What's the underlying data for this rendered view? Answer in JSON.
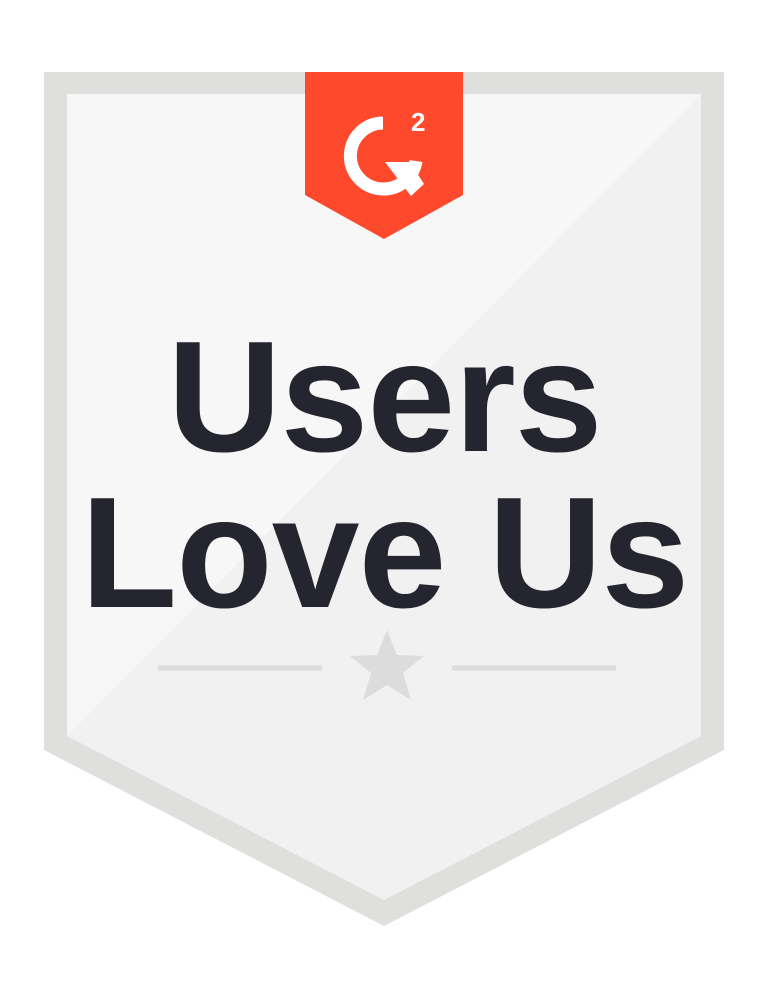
{
  "badge": {
    "logo_text": "G2",
    "headline_line1": "Users",
    "headline_line2": "Love Us"
  },
  "colors": {
    "brand_red": "#ff492c",
    "border_gray": "#dfe0de",
    "panel_left": "#f6f6f6",
    "panel_right": "#f0f0f0",
    "text_dark": "#252530",
    "star_gray": "#dcdcdc"
  },
  "icons": {
    "logo": "g2-logo-icon",
    "divider_star": "star-icon"
  }
}
